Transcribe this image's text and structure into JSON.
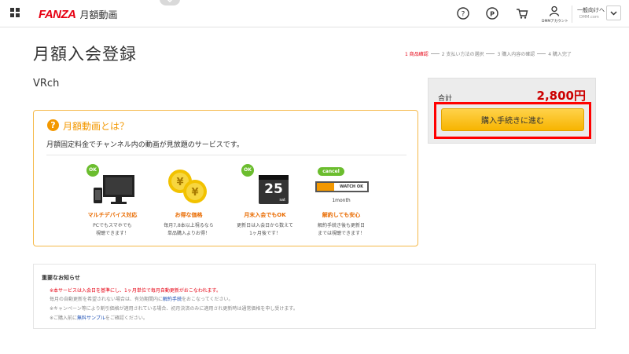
{
  "header": {
    "logo_brand": "FANZA",
    "logo_sub": "月額動画",
    "account_label": "DMMアカウント",
    "region_label": "一般向けへ",
    "region_sub": "DMM.com"
  },
  "page": {
    "title": "月額入会登録",
    "steps": [
      "1 商品確認",
      "2 支払い方法の選択",
      "3 購入内容の確認",
      "4 購入完了"
    ],
    "product_name": "VRch"
  },
  "summary": {
    "total_label": "合計",
    "total_value": "2,800円",
    "buy_button": "購入手続きに進む"
  },
  "info": {
    "title": "月額動画とは？",
    "description": "月額固定料金でチャンネル内の動画が見放題のサービスです。",
    "features": [
      {
        "icon": "multi-device-icon",
        "badge": "OK",
        "title": "マルチデバイス対応",
        "line1": "PCでもスマホでも",
        "line2": "視聴できます！"
      },
      {
        "icon": "yen-coins-icon",
        "title": "お得な価格",
        "line1": "毎月7,8本以上視るなら",
        "line2": "単品購入よりお得！"
      },
      {
        "icon": "calendar-icon",
        "badge": "OK",
        "calendar_day": "25",
        "calendar_sub": "sat",
        "title": "月末入会でもOK",
        "line1": "更新日は入会日から数えて",
        "line2": "1ヶ月後です！"
      },
      {
        "icon": "cancel-timeline-icon",
        "cancel_label": "cancel",
        "watch_label": "WATCH OK",
        "month_label": "1month",
        "title": "解約しても安心",
        "line1": "解約手続き後も更新日",
        "line2": "までは視聴できます！"
      }
    ]
  },
  "notice": {
    "title": "重要なお知らせ",
    "line1": "※本サービスは入会日を基準にし、1ヶ月単位で毎月自動更新がおこなわれます。",
    "line2_pre": "毎月の自動更新を希望されない場合は、有効期間内に",
    "line2_link": "解約手続",
    "line2_post": "をおこなってください。",
    "line3": "※キャンペーン等により割引価格が適用されている場合、初月決済のみに適用され更新時は通常価格を申し受けます。",
    "line4_pre": "※ご購入前に",
    "line4_link": "無料サンプル",
    "line4_post": "をご確認ください。"
  },
  "colors": {
    "brand_red": "#e60012",
    "accent_orange": "#f39800",
    "button_yellow": "#f7b400",
    "highlight_red": "#ff0000",
    "ok_green": "#6bbd2e"
  }
}
